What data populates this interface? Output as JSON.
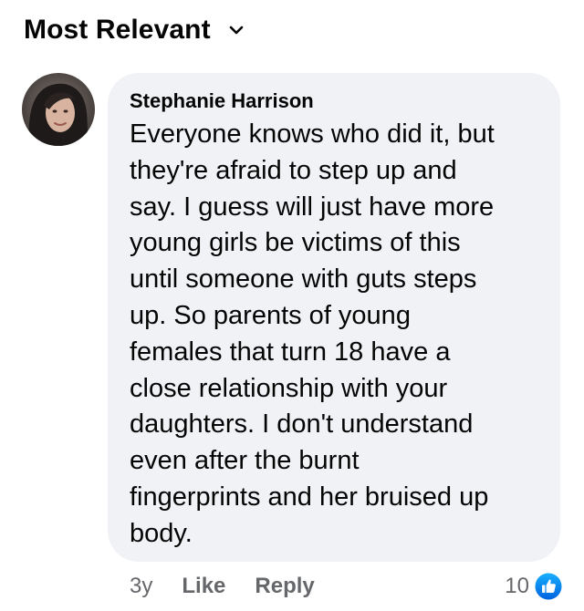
{
  "sort": {
    "label": "Most Relevant",
    "icon": "chevron-down-icon"
  },
  "comment": {
    "author": "Stephanie Harrison",
    "avatar_icon": "user-avatar",
    "text": "Everyone knows who did it, but\nthey're afraid to step up and\nsay. I guess will just have more\nyoung girls be victims of this\nuntil someone with guts steps\nup. So parents of young\nfemales that turn 18 have a\nclose relationship with your\ndaughters. I don't understand\neven after the burnt\nfingerprints and her bruised up\nbody.",
    "timestamp": "3y",
    "like_label": "Like",
    "reply_label": "Reply",
    "reaction_count": "10",
    "reaction_icon": "like-thumb-icon"
  },
  "colors": {
    "bubble_bg": "#f0f2f5",
    "text": "#050505",
    "muted": "#65676b",
    "like_blue": "#1877f2"
  }
}
